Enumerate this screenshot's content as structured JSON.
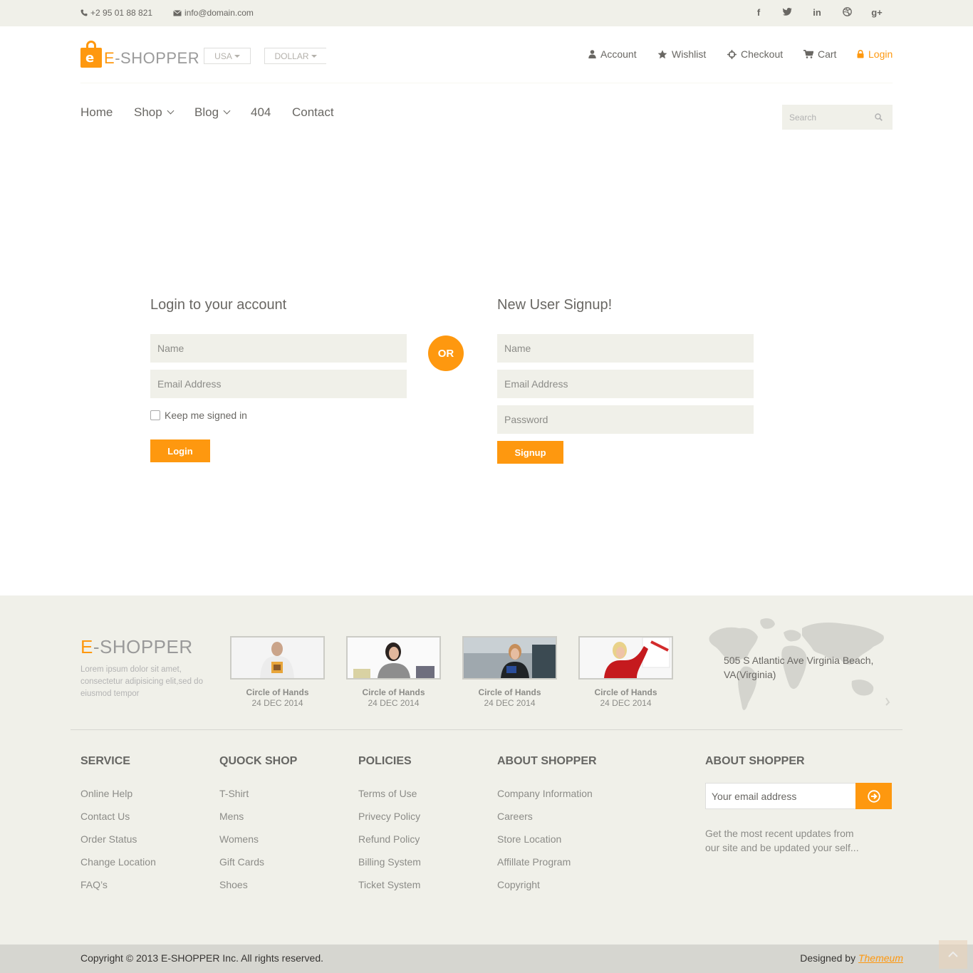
{
  "topbar": {
    "phone": "+2 95 01 88 821",
    "email": "info@domain.com",
    "social": [
      {
        "name": "facebook-icon",
        "glyph": "f"
      },
      {
        "name": "twitter-icon",
        "glyph": "t"
      },
      {
        "name": "linkedin-icon",
        "glyph": "in"
      },
      {
        "name": "dribbble-icon",
        "glyph": "⊛"
      },
      {
        "name": "google-plus-icon",
        "glyph": "g+"
      }
    ]
  },
  "header": {
    "logo_prefix": "E",
    "logo_rest": "-SHOPPER",
    "logo_bag_letter": "e",
    "country": "USA",
    "currency": "DOLLAR",
    "nav": [
      {
        "label": "Account",
        "icon": "user-icon"
      },
      {
        "label": "Wishlist",
        "icon": "star-icon"
      },
      {
        "label": "Checkout",
        "icon": "crosshairs-icon"
      },
      {
        "label": "Cart",
        "icon": "shopping-cart-icon"
      },
      {
        "label": "Login",
        "icon": "lock-icon",
        "active": true
      }
    ]
  },
  "mainnav": {
    "items": [
      {
        "label": "Home"
      },
      {
        "label": "Shop",
        "dropdown": true
      },
      {
        "label": "Blog",
        "dropdown": true
      },
      {
        "label": "404"
      },
      {
        "label": "Contact"
      }
    ],
    "search_placeholder": "Search"
  },
  "login": {
    "title": "Login to your account",
    "name_placeholder": "Name",
    "email_placeholder": "Email Address",
    "keep_signed": "Keep me signed in",
    "button": "Login"
  },
  "or_label": "OR",
  "signup": {
    "title": "New User Signup!",
    "name_placeholder": "Name",
    "email_placeholder": "Email Address",
    "password_placeholder": "Password",
    "button": "Signup"
  },
  "footer": {
    "logo_prefix": "E",
    "logo_rest": "-SHOPPER",
    "description": "Lorem ipsum dolor sit amet, consectetur adipisicing elit,sed do eiusmod tempor",
    "videos": [
      {
        "title": "Circle of Hands",
        "date": "24 DEC 2014"
      },
      {
        "title": "Circle of Hands",
        "date": "24 DEC 2014"
      },
      {
        "title": "Circle of Hands",
        "date": "24 DEC 2014"
      },
      {
        "title": "Circle of Hands",
        "date": "24 DEC 2014"
      }
    ],
    "address": "505 S Atlantic Ave Virginia Beach, VA(Virginia)",
    "columns": [
      {
        "title": "SERVICE",
        "links": [
          "Online Help",
          "Contact Us",
          "Order Status",
          "Change Location",
          "FAQ’s"
        ]
      },
      {
        "title": "QUOCK SHOP",
        "links": [
          "T-Shirt",
          "Mens",
          "Womens",
          "Gift Cards",
          "Shoes"
        ]
      },
      {
        "title": "POLICIES",
        "links": [
          "Terms of Use",
          "Privecy Policy",
          "Refund Policy",
          "Billing System",
          "Ticket System"
        ]
      },
      {
        "title": "ABOUT SHOPPER",
        "links": [
          "Company Information",
          "Careers",
          "Store Location",
          "Affillate Program",
          "Copyright"
        ]
      }
    ],
    "subscribe": {
      "title": "ABOUT SHOPPER",
      "placeholder": "Your email address",
      "note": "Get the most recent updates from our site and be updated your self..."
    },
    "copyright": "Copyright © 2013 E-SHOPPER Inc. All rights reserved.",
    "designed_by": "Designed by",
    "designer": "Themeum"
  },
  "colors": {
    "accent": "#FE980F",
    "panel": "#F0F0E9",
    "footer_bottom": "#D6D6D0",
    "text": "#696763"
  }
}
